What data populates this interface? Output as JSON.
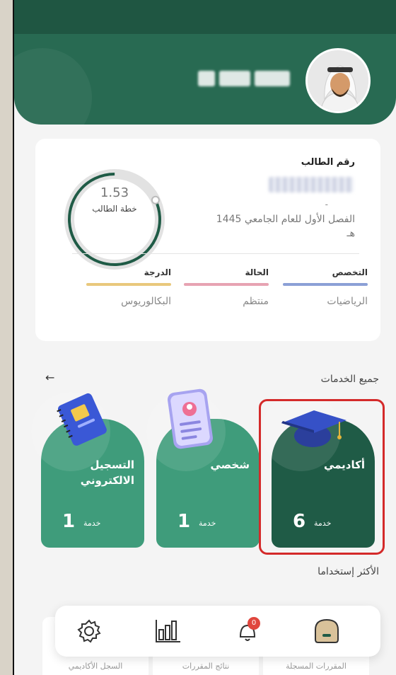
{
  "colors": {
    "brand_dark": "#1f5b46",
    "brand_light": "#3f9c7b",
    "header": "#286a52"
  },
  "student": {
    "id_label": "رقم الطالب",
    "id_dash": "-",
    "semester": "الفصل الأول للعام الجامعي 1445 هـ",
    "gpa": "1.53",
    "plan_label": "خطة الطالب",
    "progress_fraction": 0.82
  },
  "stats": [
    {
      "title": "التخصص",
      "value": "الرياضيات",
      "color": "#8ba0d6"
    },
    {
      "title": "الحالة",
      "value": "منتظم",
      "color": "#e7a3b2"
    },
    {
      "title": "الدرجة",
      "value": "البكالوريوس",
      "color": "#e9c87c"
    }
  ],
  "services": {
    "title": "جميع الخدمات",
    "items": [
      {
        "name": "أكاديمي",
        "count": "6",
        "unit": "خدمة",
        "icon": "graduation-cap-icon"
      },
      {
        "name": "شخصي",
        "count": "1",
        "unit": "خدمة",
        "icon": "id-card-icon"
      },
      {
        "name": "التسجيل الالكتروني",
        "count": "1",
        "unit": "خدمة",
        "icon": "notebook-icon"
      }
    ]
  },
  "most_used": {
    "title": "الأكثر إستخداما",
    "items": [
      {
        "label": "المقررات المسجلة"
      },
      {
        "label": "نتائج المقررات"
      },
      {
        "label": "السجل الأكاديمي"
      }
    ]
  },
  "nav": {
    "notifications_badge": "0"
  }
}
